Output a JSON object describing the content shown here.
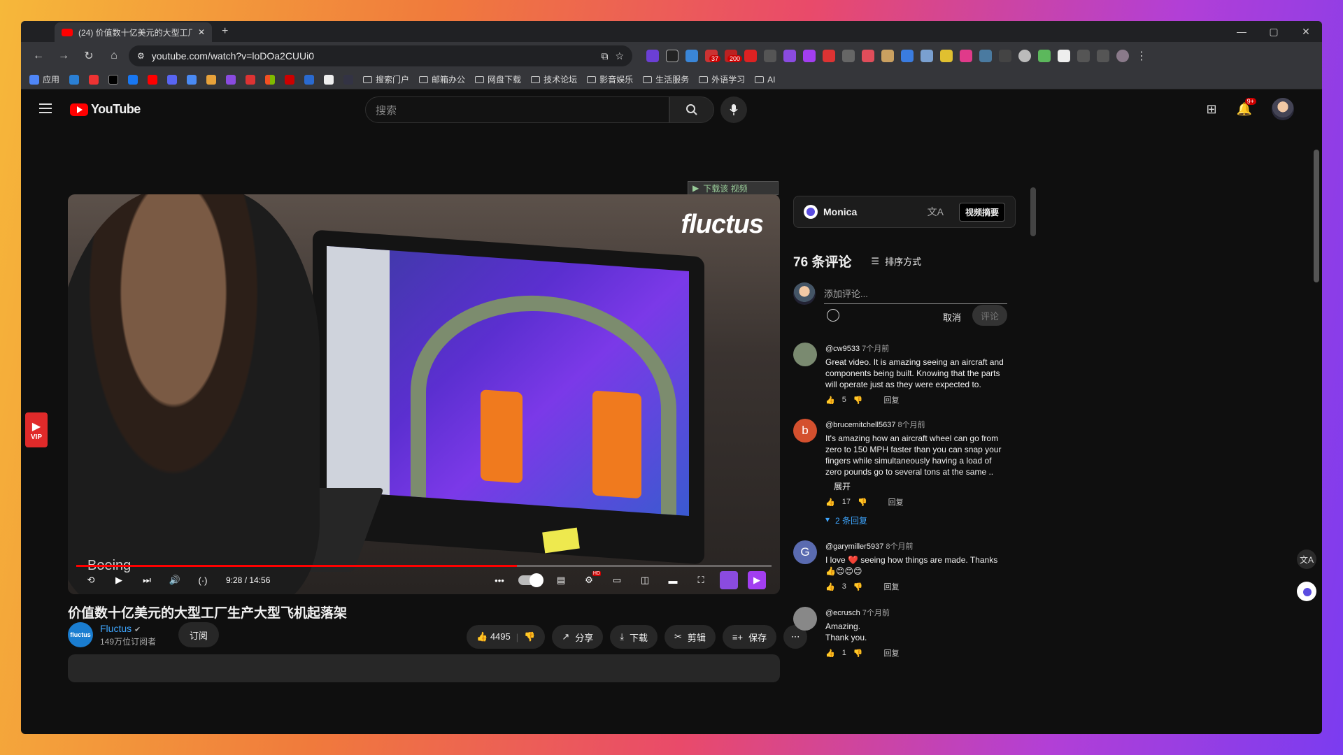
{
  "browser": {
    "tab_title": "(24) 价值数十亿美元的大型工厂",
    "new_tab": "+",
    "url": "youtube.com/watch?v=loDOa2CUUi0",
    "ext_badges": [
      "37",
      "200"
    ],
    "bookmarks": {
      "apps": "应用",
      "folders": [
        "搜索门户",
        "邮箱办公",
        "网盘下载",
        "技术论坛",
        "影音娱乐",
        "生活服务",
        "外语学习",
        "AI"
      ]
    }
  },
  "youtube": {
    "logo": "YouTube",
    "search_placeholder": "搜索",
    "notif_badge": "9+",
    "vip_label": "VIP",
    "download_overlay": "下载该 视频",
    "player": {
      "caption": "Boeing",
      "watermark": "fluctus",
      "time": "9:28 / 14:56",
      "progress": 0.634,
      "hd_badge": "HD"
    },
    "video": {
      "title": "价值数十亿美元的大型工厂生产大型飞机起落架",
      "channel": "Fluctus",
      "channel_avatar_text": "fluctus",
      "subscribers": "149万位订阅者",
      "subscribe": "订阅",
      "likes": "4495",
      "share": "分享",
      "download": "下载",
      "clip": "剪辑",
      "save": "保存"
    },
    "monica": {
      "name": "Monica",
      "summary_button": "视频摘要"
    },
    "comments_header": {
      "count": "76 条评论",
      "sort": "排序方式"
    },
    "add_comment": {
      "placeholder": "添加评论...",
      "cancel": "取消",
      "post": "评论"
    },
    "comments": [
      {
        "author": "@cw9533",
        "ago": "7个月前",
        "text": "Great video. It is amazing seeing an aircraft and components being built. Knowing that the parts will operate just as they were expected to.",
        "likes": "5",
        "reply": "回复",
        "avatar_color": "#7a8a70",
        "avatar_letter": ""
      },
      {
        "author": "@brucemitchell5637",
        "ago": "8个月前",
        "text": "It's amazing how an aircraft wheel can go from zero to 150 MPH faster than you can snap your fingers while simultaneously having a load of zero pounds go to several tons at the same ..",
        "more": "展开",
        "likes": "17",
        "reply": "回复",
        "replies": "2 条回复",
        "avatar_color": "#d4502e",
        "avatar_letter": "b"
      },
      {
        "author": "@garymiller5937",
        "ago": "8个月前",
        "text": "I love ❤️ seeing how things are made. Thanks 👍😊😊😊",
        "likes": "3",
        "reply": "回复",
        "avatar_color": "#5a6bb0",
        "avatar_letter": "G"
      },
      {
        "author": "@ecrusch",
        "ago": "7个月前",
        "text": "Amazing.\nThank you.",
        "likes": "1",
        "reply": "回复",
        "avatar_color": "#888888",
        "avatar_letter": ""
      }
    ]
  }
}
